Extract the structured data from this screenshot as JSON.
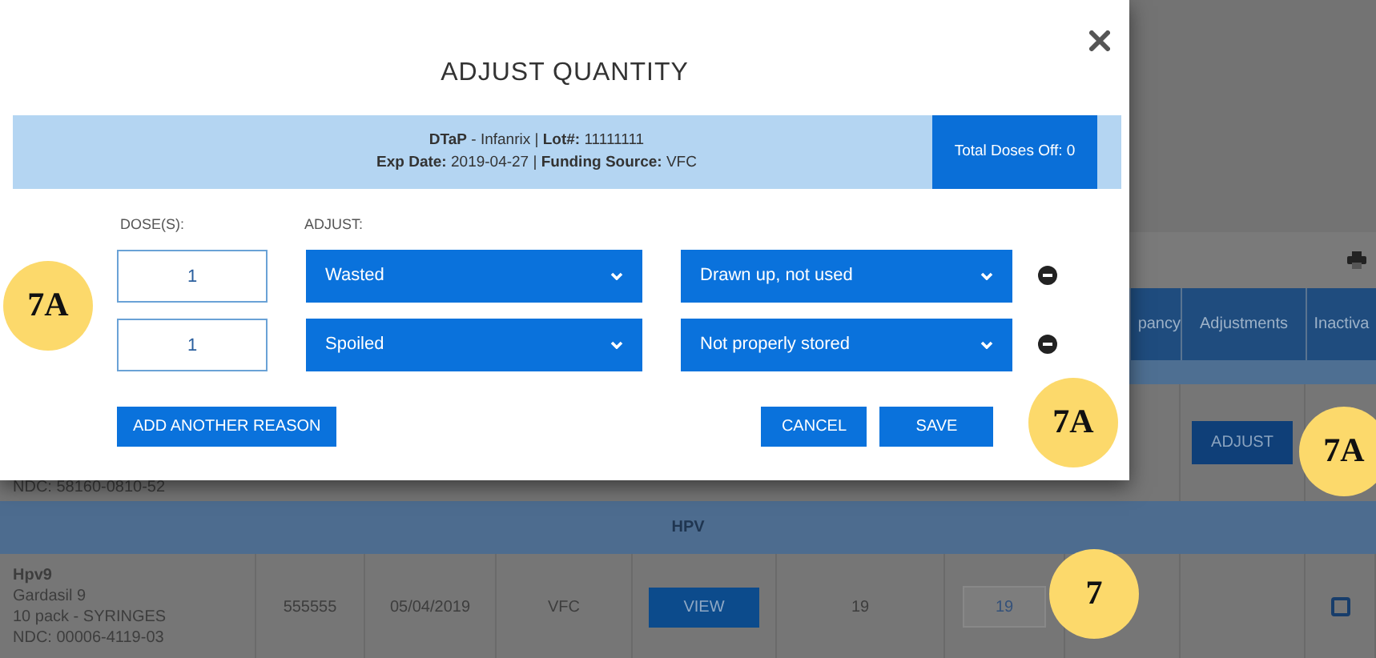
{
  "modal": {
    "title": "ADJUST QUANTITY",
    "info_lines": [
      "**DTaP** - Infanrix | **Lot#:** 11111111",
      "**Exp Date:** 2019-04-27 | **Funding Source:** VFC"
    ],
    "total_doses": "Total Doses Off: 0",
    "column_labels": [
      "DOSE(S):",
      "ADJUST:"
    ],
    "rows": [
      {
        "doses": "1",
        "reason": "Wasted",
        "detail": "Drawn up, not used"
      },
      {
        "doses": "1",
        "reason": "Spoiled",
        "detail": "Not properly stored"
      }
    ],
    "add_button": "ADD ANOTHER REASON",
    "cancel_button": "CANCEL",
    "save_button": "SAVE"
  },
  "background": {
    "headers": [
      "pancy",
      "Adjustments",
      "Inactiva"
    ],
    "partial_row": {
      "ndc": "NDC: 58160-0810-52",
      "adjust_button": "ADJUST"
    },
    "group": "HPV",
    "row": {
      "product": [
        "Hpv9",
        "Gardasil 9",
        "10 pack - SYRINGES",
        "NDC: 00006-4119-03"
      ],
      "lot": "555555",
      "exp": "05/04/2019",
      "funding": "VFC",
      "view_button": "VIEW",
      "count": "19",
      "input": "19",
      "inactivate_checked": false
    }
  },
  "annotations": [
    {
      "label": "7A"
    },
    {
      "label": "7A"
    },
    {
      "label": "7A"
    },
    {
      "label": "7"
    }
  ]
}
